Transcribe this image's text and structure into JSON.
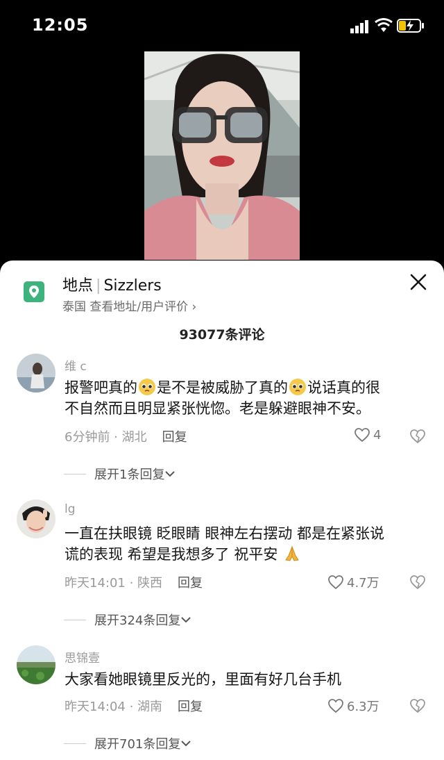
{
  "status_bar": {
    "time": "12:05"
  },
  "location": {
    "label": "地点",
    "name": "Sizzlers",
    "subtitle": "泰国 查看地址/用户评价 ›"
  },
  "comment_count": "93077条评论",
  "comments": [
    {
      "user": "维 c",
      "text_parts": [
        "报警吧真的",
        "是不是被威胁了真的",
        "说话真的很",
        "不自然而且明显紧张恍惚。老是躲避眼神不安。"
      ],
      "meta": "6分钟前 · 湖北",
      "reply": "回复",
      "likes": "4",
      "expand": "展开1条回复"
    },
    {
      "user": "lg",
      "text_line1": "一直在扶眼镜 眨眼睛 眼神左右摆动 都是在紧张说",
      "text_line2": "谎的表现 希望是我想多了 祝平安",
      "meta": "昨天14:01 · 陕西",
      "reply": "回复",
      "likes": "4.7万",
      "expand": "展开324条回复"
    },
    {
      "user": "思锦壹",
      "text": "大家看她眼镜里反光的，里面有好几台手机",
      "meta": "昨天14:04 · 湖南",
      "reply": "回复",
      "likes": "6.3万",
      "expand": "展开701条回复"
    }
  ]
}
